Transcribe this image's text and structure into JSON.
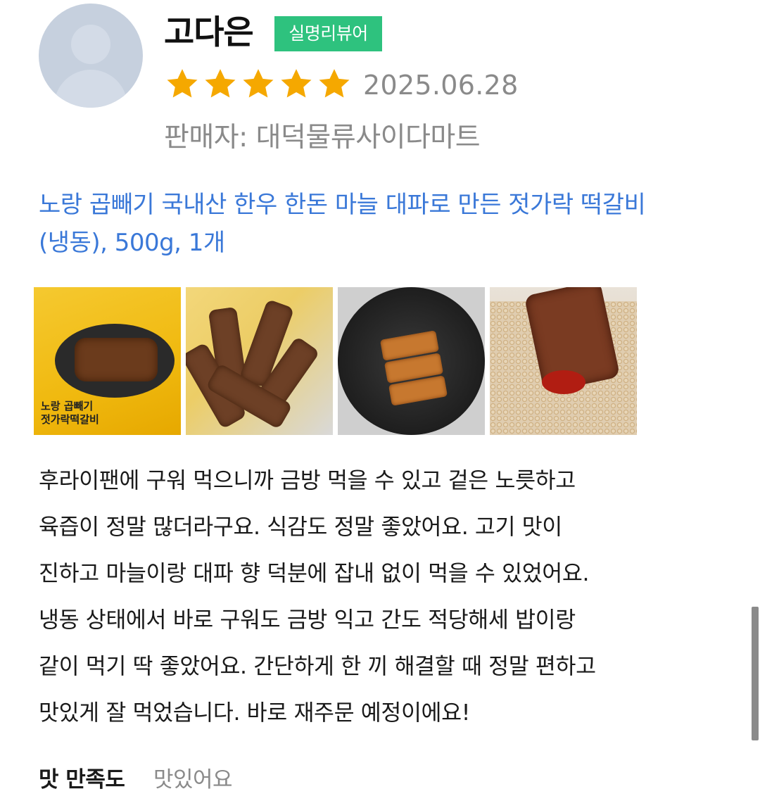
{
  "reviewer": {
    "name": "고다은",
    "badge": "실명리뷰어",
    "rating": 5,
    "date": "2025.06.28",
    "seller": "판매자: 대덕물류사이다마트"
  },
  "product": {
    "title_line1": "노랑 곱빼기 국내산 한우 한돈 마늘 대파로 만든 젓가락 떡갈비",
    "title_line2": "(냉동), 500g, 1개"
  },
  "photos": {
    "count": 4,
    "package_label": "노랑 곱빼기\n젓가락떡갈비"
  },
  "review": {
    "lines": [
      "후라이팬에 구워 먹으니까 금방 먹을 수 있고 겉은 노릇하고",
      "육즙이 정말 많더라구요. 식감도 정말 좋았어요. 고기 맛이",
      "진하고 마늘이랑 대파 향 덕분에 잡내 없이 먹을 수 있었어요.",
      "냉동 상태에서 바로 구워도 금방 익고 간도 적당해세 밥이랑",
      "같이 먹기 딱 좋았어요. 간단하게 한 끼 해결할 때 정말 편하고",
      "맛있게 잘 먹었습니다. 바로 재주문 예정이에요!"
    ]
  },
  "satisfaction": {
    "label": "맛 만족도",
    "value": "맛있어요"
  },
  "colors": {
    "badge": "#2ec27e",
    "star": "#f5a800",
    "product_link": "#3a78d8",
    "muted_text": "#8a8a8a"
  }
}
